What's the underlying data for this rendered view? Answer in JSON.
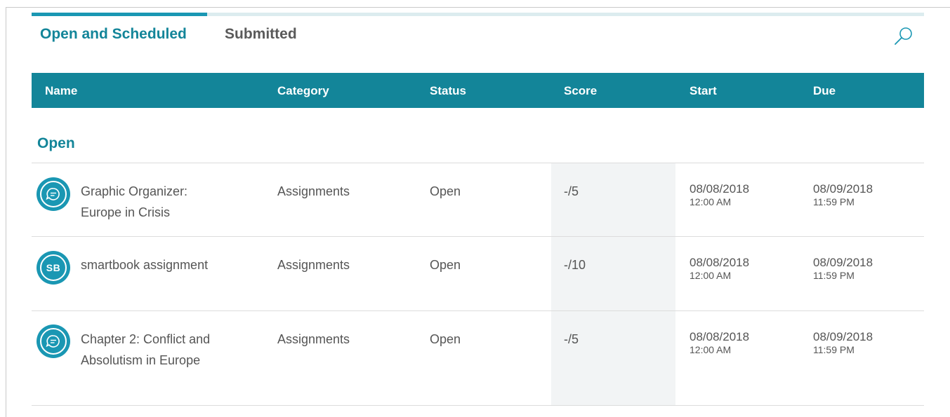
{
  "tabs": [
    {
      "label": "Open and Scheduled",
      "active": true
    },
    {
      "label": "Submitted",
      "active": false
    }
  ],
  "search": {
    "icon": "search-icon"
  },
  "table": {
    "headers": [
      "Name",
      "Category",
      "Status",
      "Score",
      "Start",
      "Due"
    ]
  },
  "sections": [
    {
      "title": "Open",
      "rows": [
        {
          "icon": "chat-bubble-icon",
          "name": "Graphic Organizer: Europe in Crisis",
          "category": "Assignments",
          "status": "Open",
          "score": "-/5",
          "start_date": "08/08/2018",
          "start_time": "12:00 AM",
          "due_date": "08/09/2018",
          "due_time": "11:59 PM"
        },
        {
          "icon": "smartbook-icon",
          "icon_text": "SB",
          "name": "smartbook assignment",
          "category": "Assignments",
          "status": "Open",
          "score": "-/10",
          "start_date": "08/08/2018",
          "start_time": "12:00 AM",
          "due_date": "08/09/2018",
          "due_time": "11:59 PM"
        },
        {
          "icon": "chat-bubble-icon",
          "name": "Chapter 2: Conflict and Absolutism in Europe",
          "category": "Assignments",
          "status": "Open",
          "score": "-/5",
          "start_date": "08/08/2018",
          "start_time": "12:00 AM",
          "due_date": "08/09/2018",
          "due_time": "11:59 PM"
        }
      ]
    }
  ],
  "colors": {
    "accent": "#138599",
    "tab_indicator": "#1a97b3",
    "tab_track": "#dcecef",
    "score_band": "#f2f4f5"
  }
}
